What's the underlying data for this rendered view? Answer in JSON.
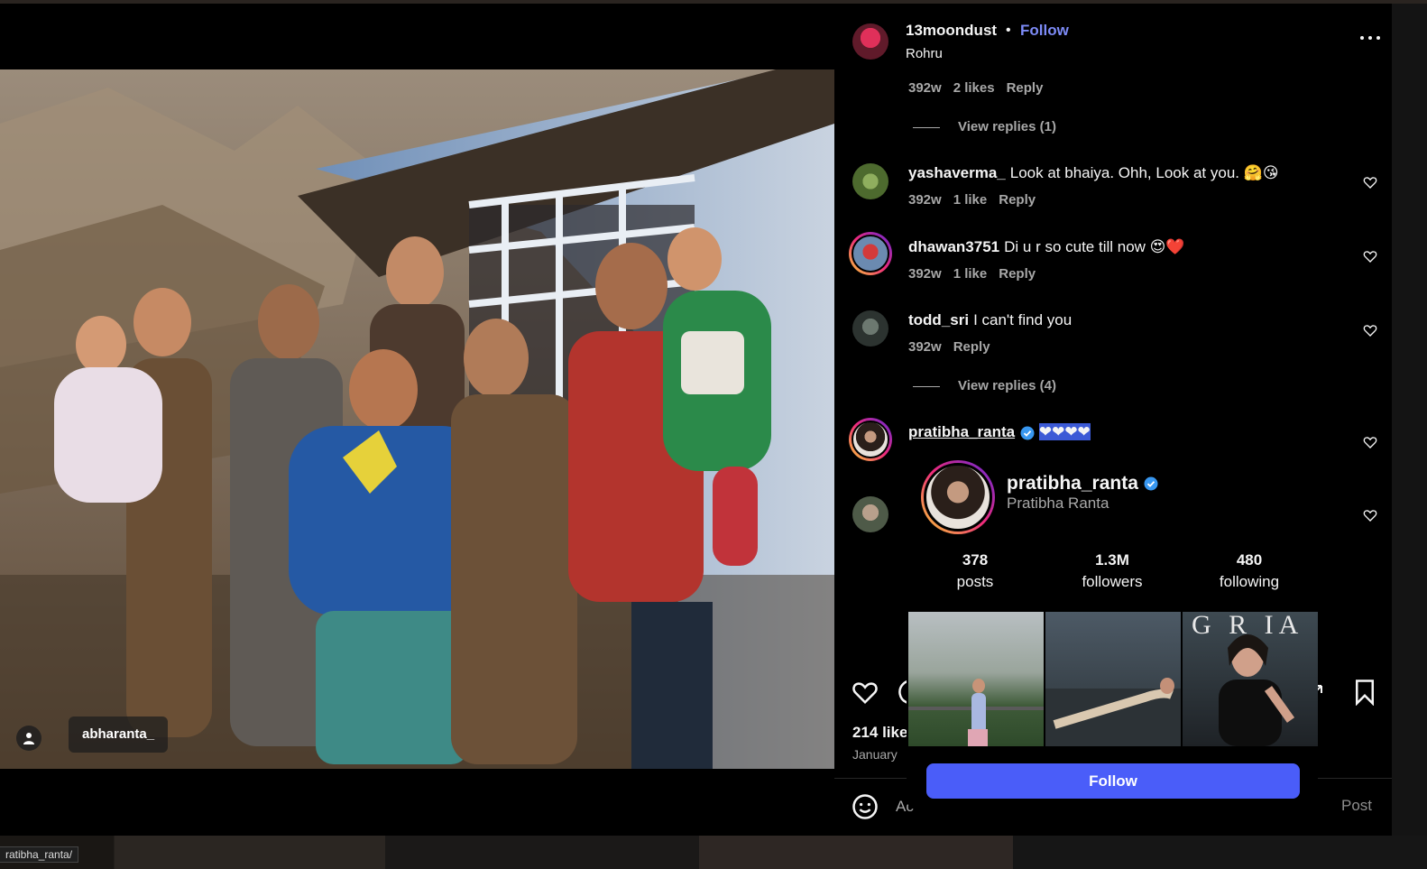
{
  "url_hint": "ratibha_ranta/",
  "media": {
    "tagged_user": "abharanta_",
    "tag_icon": "person-icon"
  },
  "post": {
    "owner": "13moondust",
    "separator": "•",
    "follow_label": "Follow",
    "location": "Rohru"
  },
  "comments": {
    "first_reply_meta": {
      "age": "392w",
      "likes": "2 likes",
      "reply": "Reply"
    },
    "view_replies_1": "View replies (1)",
    "items": [
      {
        "user": "yashaverma_",
        "text": "Look at bhaiya. Ohh, Look at you. 🤗😘",
        "age": "392w",
        "likes": "1 like",
        "reply": "Reply"
      },
      {
        "user": "dhawan3751",
        "text": "Di u r so cute till now 😍❤️",
        "age": "392w",
        "likes": "1 like",
        "reply": "Reply"
      },
      {
        "user": "todd_sri",
        "text": "I can't find you",
        "age": "392w",
        "reply": "Reply"
      },
      {
        "user": "pratibha_ranta",
        "text": "❤❤❤❤"
      }
    ],
    "view_replies_2": "View replies (4)"
  },
  "actions": {
    "likes": "214 like",
    "date": "January",
    "comment_placeholder": "Ac",
    "post_label": "Post"
  },
  "hover_card": {
    "username": "pratibha_ranta",
    "full_name": "Pratibha Ranta",
    "stats": [
      {
        "value": "378",
        "label": "posts"
      },
      {
        "value": "1.3M",
        "label": "followers"
      },
      {
        "value": "480",
        "label": "following"
      }
    ],
    "thumb_text": "G R  IA",
    "follow_label": "Follow"
  },
  "colors": {
    "accent": "#4a5df9",
    "follow_link": "#7d8bf7",
    "verified": "#3897f0",
    "muted": "#a8a8a8"
  }
}
